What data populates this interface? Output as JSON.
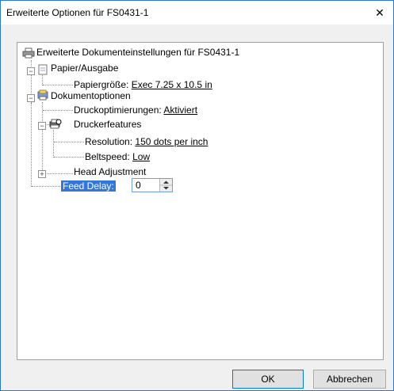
{
  "window": {
    "title": "Erweiterte Optionen für FS0431-1",
    "close_glyph": "✕"
  },
  "tree": {
    "root": "Erweiterte Dokumenteinstellungen für FS0431-1",
    "papier": {
      "label": "Papier/Ausgabe",
      "size_label": "Papiergröße:",
      "size_value": "Exec 7.25 x 10.5 in"
    },
    "dokument": {
      "label": "Dokumentoptionen",
      "druckopt_label": "Druckoptimierungen:",
      "druckopt_value": "Aktiviert",
      "features": {
        "label": "Druckerfeatures",
        "resolution_label": "Resolution:",
        "resolution_value": "150 dots per inch",
        "beltspeed_label": "Beltspeed:",
        "beltspeed_value": "Low"
      }
    },
    "head_adjustment": "Head Adjustment",
    "feed_delay": {
      "label": "Feed Delay:",
      "value": "0"
    }
  },
  "buttons": {
    "ok": "OK",
    "cancel": "Abbrechen"
  }
}
